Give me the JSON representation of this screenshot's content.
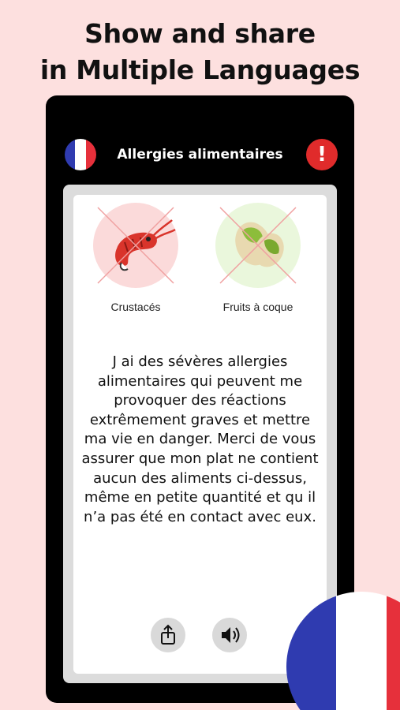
{
  "headline": {
    "line1": "Show and share",
    "line2": "in Multiple Languages"
  },
  "topbar": {
    "title": "Allergies alimentaires",
    "flag_icon": "france-flag-icon",
    "alert_icon": "exclamation-icon",
    "alert_symbol": "!"
  },
  "allergens": [
    {
      "label": "Crustacés",
      "icon": "shrimp-icon",
      "color": "#fbdada"
    },
    {
      "label": "Fruits à coque",
      "icon": "pistachio-icon",
      "color": "#eaf7dc"
    }
  ],
  "message": "J ai des sévères allergies alimentaires qui peuvent me provoquer des réactions extrêmement graves et mettre ma vie en danger. Merci de vous assurer que mon plat ne contient aucun des aliments ci-dessus, même en petite quantité et qu il n’a pas été en contact avec eux.",
  "actions": [
    {
      "icon": "share-icon"
    },
    {
      "icon": "speaker-icon"
    }
  ],
  "colors": {
    "background": "#fde0df",
    "alert": "#e02b2b",
    "flag_blue": "#2f3bb0",
    "flag_white": "#ffffff",
    "flag_red": "#e6303b"
  }
}
